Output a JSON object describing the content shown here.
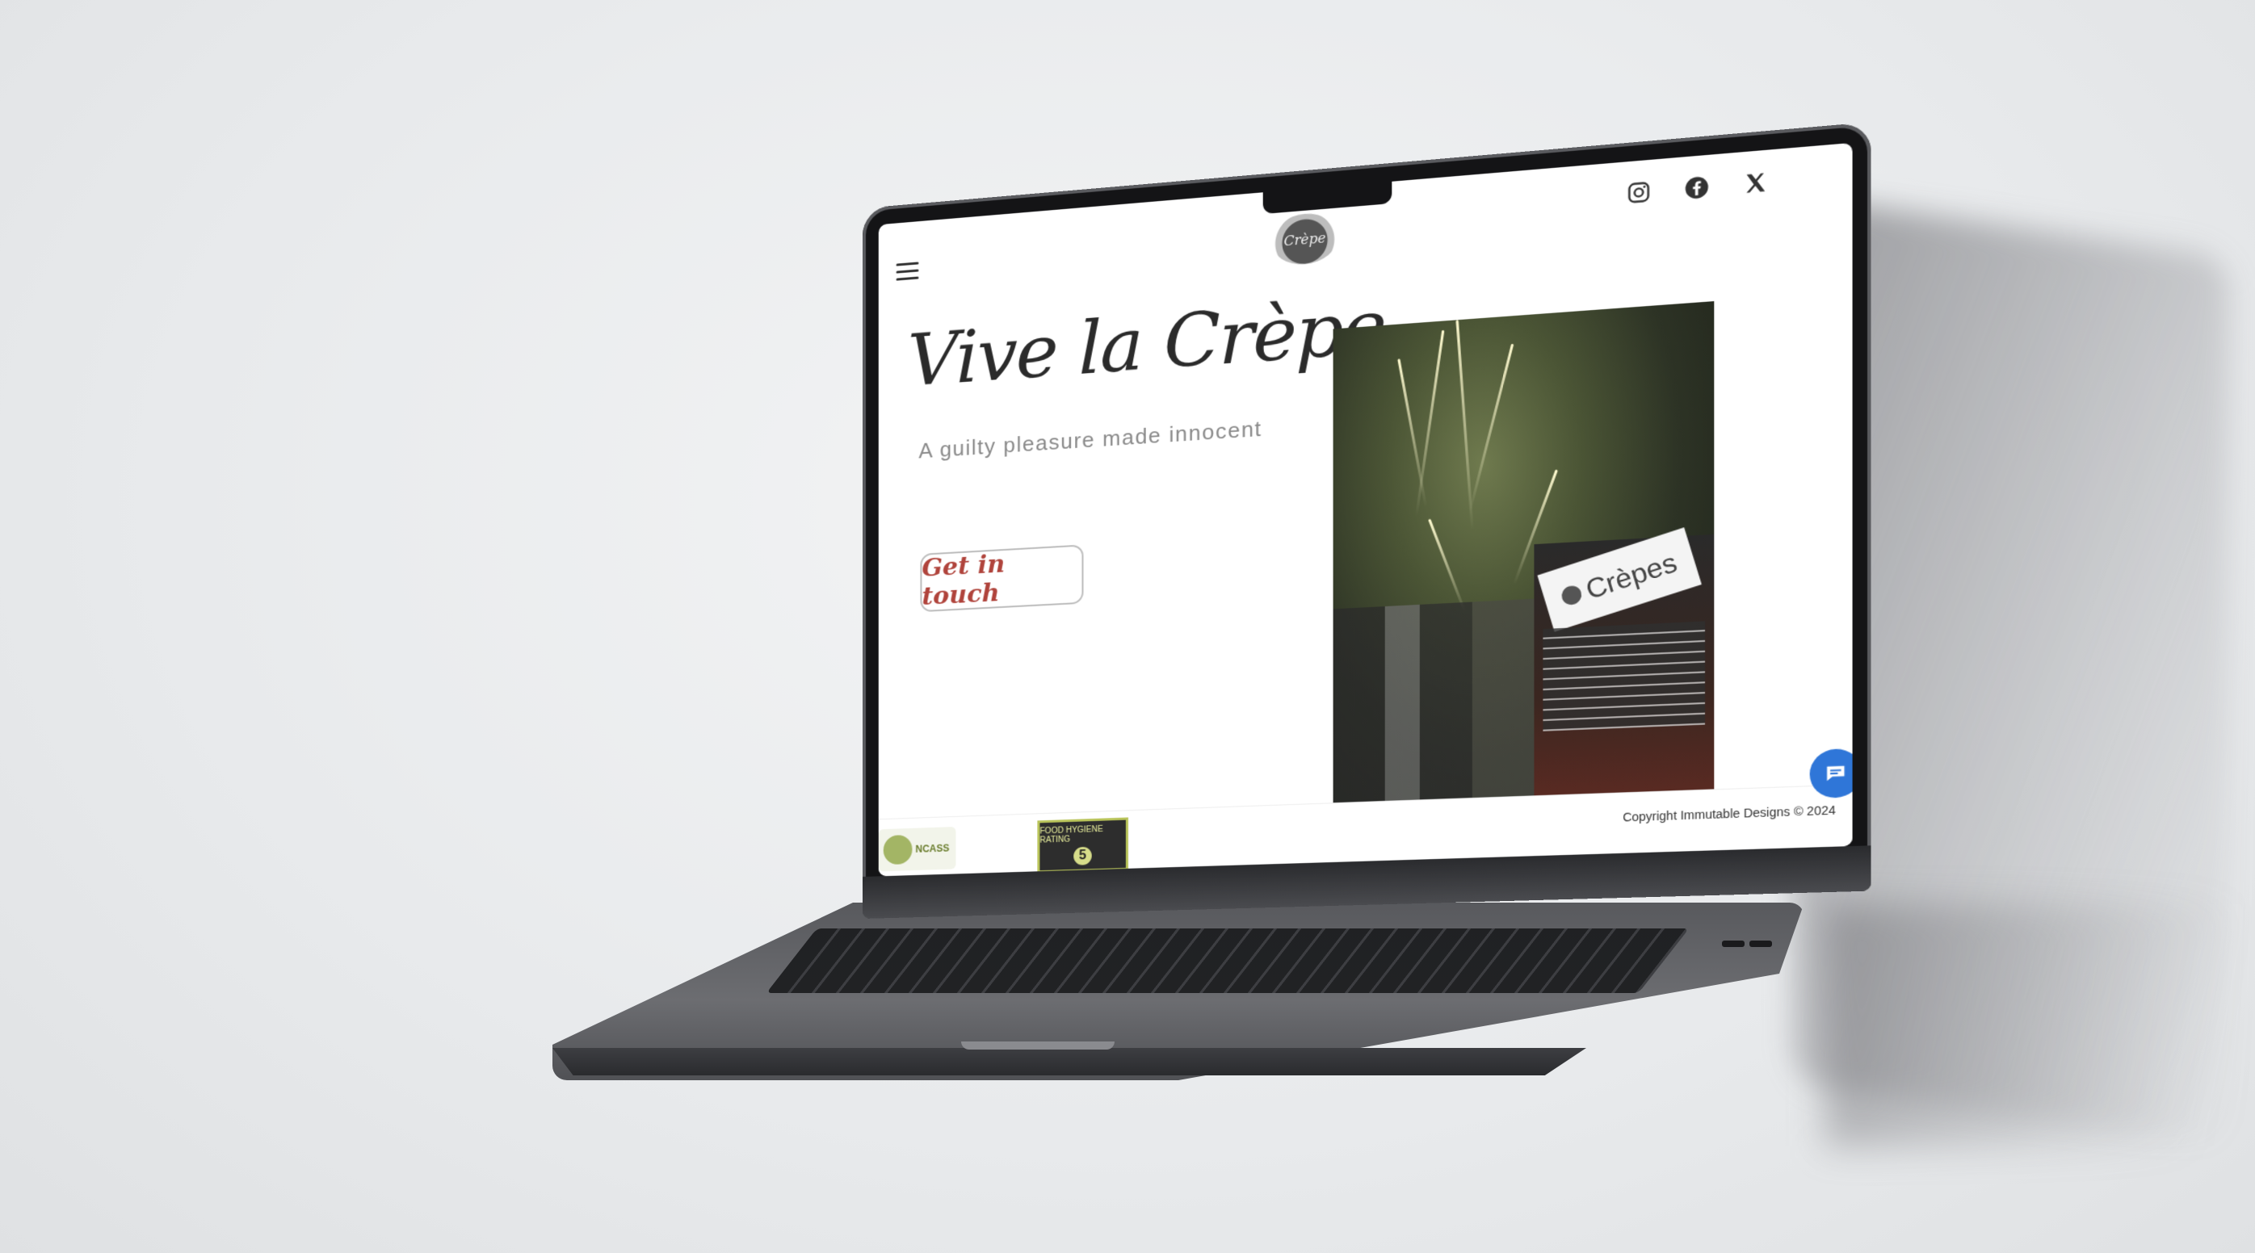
{
  "site": {
    "brand": "Vive la Crèpe",
    "tagline": "A guilty pleasure made innocent",
    "cta_label": "Get in touch",
    "logo_text": "Crèpe",
    "footer": {
      "copyright": "Copyright Immutable Designs © 2024",
      "ncass_badge_text": "NCASS",
      "food_hygiene_rating_label": "FOOD HYGIENE RATING",
      "food_hygiene_rating_value": "5"
    },
    "photo": {
      "sign_text": "Crèpes"
    },
    "social_icons": [
      "instagram-icon",
      "facebook-icon",
      "x-icon"
    ]
  },
  "colors": {
    "cta_text": "#b0443c",
    "chat_button": "#2f76d8",
    "brand_text": "#2b2b2b"
  }
}
